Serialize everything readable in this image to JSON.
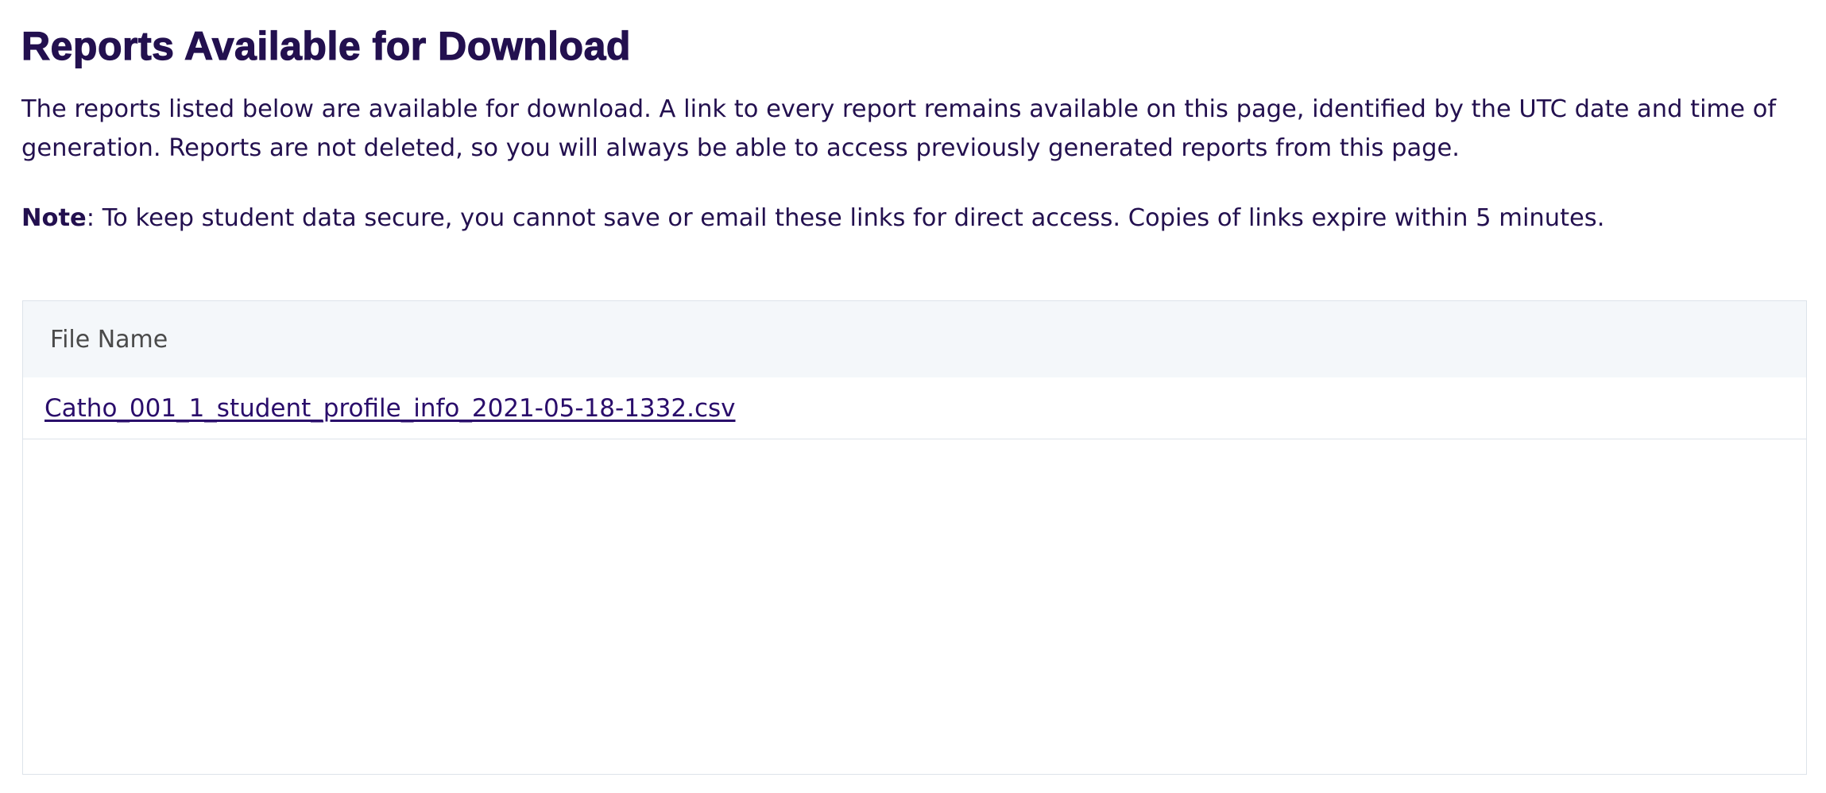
{
  "page": {
    "title": "Reports Available for Download",
    "intro": "The reports listed below are available for download. A link to every report remains available on this page, identified by the UTC date and time of generation. Reports are not deleted, so you will always be able to access previously generated reports from this page.",
    "note_label": "Note",
    "note_text": ": To keep student data secure, you cannot save or email these links for direct access. Copies of links expire within 5 minutes."
  },
  "table": {
    "columns": [
      "File Name"
    ],
    "rows": [
      {
        "file_name": "Catho_001_1_student_profile_info_2021-05-18-1332.csv"
      }
    ]
  },
  "colors": {
    "text": "#23104f",
    "link": "#2a0d6b",
    "table_header_bg": "#f4f7fa",
    "table_border": "#dde3ea"
  }
}
